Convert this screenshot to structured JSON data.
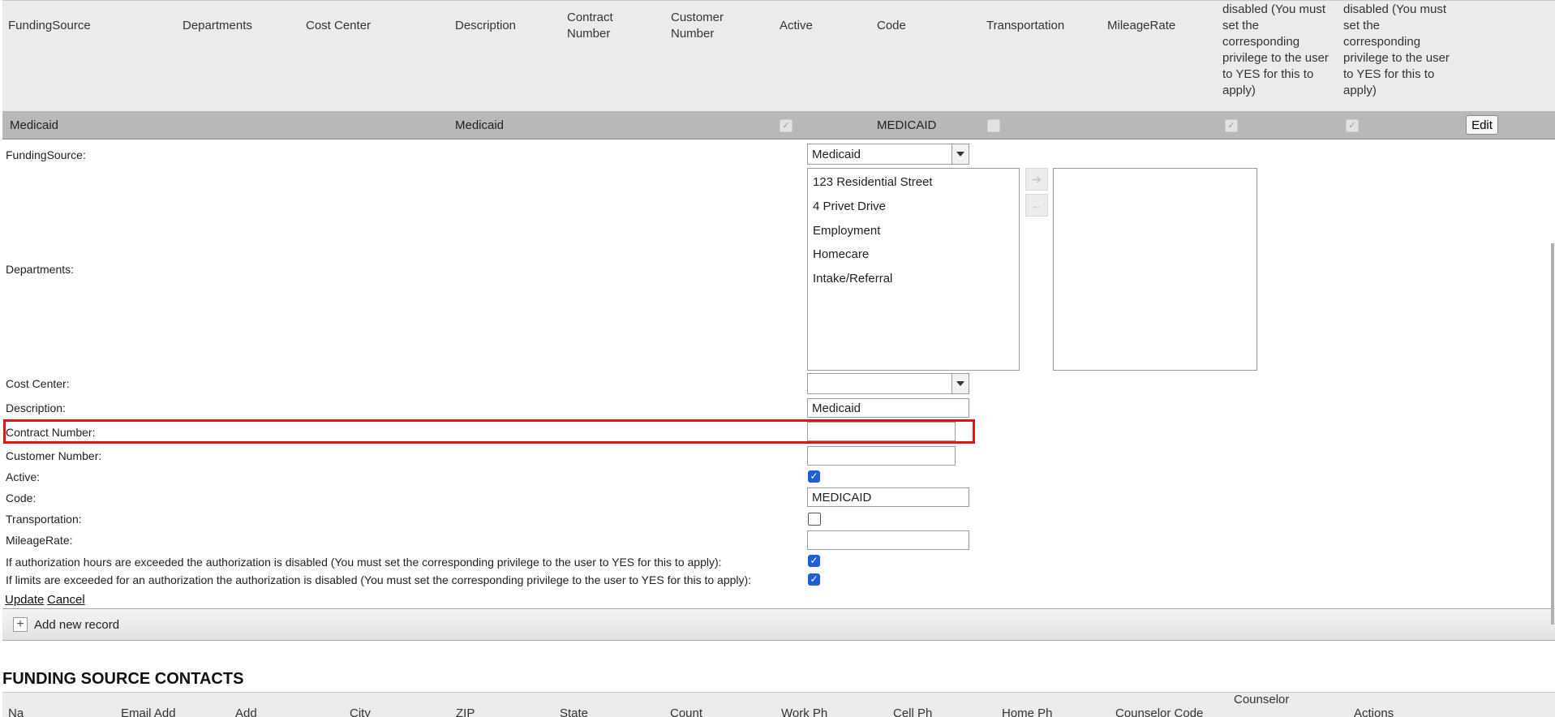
{
  "grid": {
    "headers": {
      "funding_source": "FundingSource",
      "departments": "Departments",
      "cost_center": "Cost Center",
      "description": "Description",
      "contract_number": "Contract Number",
      "customer_number": "Customer Number",
      "active": "Active",
      "code": "Code",
      "transportation": "Transportation",
      "mileage_rate": "MileageRate",
      "hours_rule": "disabled (You must set the corresponding privilege to the user to YES for this to apply)",
      "limits_rule": "authorization is disabled (You must set the corresponding privilege to the user to YES for this to apply)"
    },
    "row": {
      "funding_source": "Medicaid",
      "description": "Medicaid",
      "active": true,
      "code": "MEDICAID",
      "transportation": false,
      "hours_rule": true,
      "limits_rule": true,
      "edit_label": "Edit"
    }
  },
  "form": {
    "labels": {
      "funding_source": "FundingSource:",
      "departments": "Departments:",
      "cost_center": "Cost Center:",
      "description": "Description:",
      "contract_number": "Contract Number:",
      "customer_number": "Customer Number:",
      "active": "Active:",
      "code": "Code:",
      "transportation": "Transportation:",
      "mileage_rate": "MileageRate:",
      "hours_rule": "If authorization hours are exceeded the authorization is disabled (You must set the corresponding privilege to the user to YES for this to apply):",
      "limits_rule": "If limits are exceeded for an authorization the authorization is disabled (You must set the corresponding privilege to the user to YES for this to apply):"
    },
    "funding_source_value": "Medicaid",
    "cost_center_value": "",
    "departments_available": [
      "123 Residential Street",
      "4 Privet Drive",
      "Employment",
      "Homecare",
      "Intake/Referral"
    ],
    "departments_selected": [],
    "move_right_icon": "arrow-right-icon",
    "move_left_icon": "arrow-left-icon",
    "description_value": "Medicaid",
    "contract_number_value": "",
    "customer_number_value": "",
    "active": true,
    "code_value": "MEDICAID",
    "transportation": false,
    "mileage_rate_value": "",
    "hours_rule": true,
    "limits_rule": true,
    "update_label": "Update",
    "cancel_label": "Cancel",
    "highlight_color": "#e01414"
  },
  "toolbar": {
    "add_label": "Add new record"
  },
  "contacts": {
    "title": "FUNDING SOURCE CONTACTS",
    "headers": [
      "Na",
      "Email Add",
      "Add",
      "City",
      "ZIP",
      "State",
      "Count",
      "Work Ph",
      "Cell Ph",
      "Home Ph",
      "Counselor Code",
      "Counselor",
      "Actions"
    ]
  },
  "colors": {
    "header_bg": "#ebebeb",
    "selected_row_bg": "#b8b8b8",
    "checkbox_accent": "#1e5fd8"
  }
}
